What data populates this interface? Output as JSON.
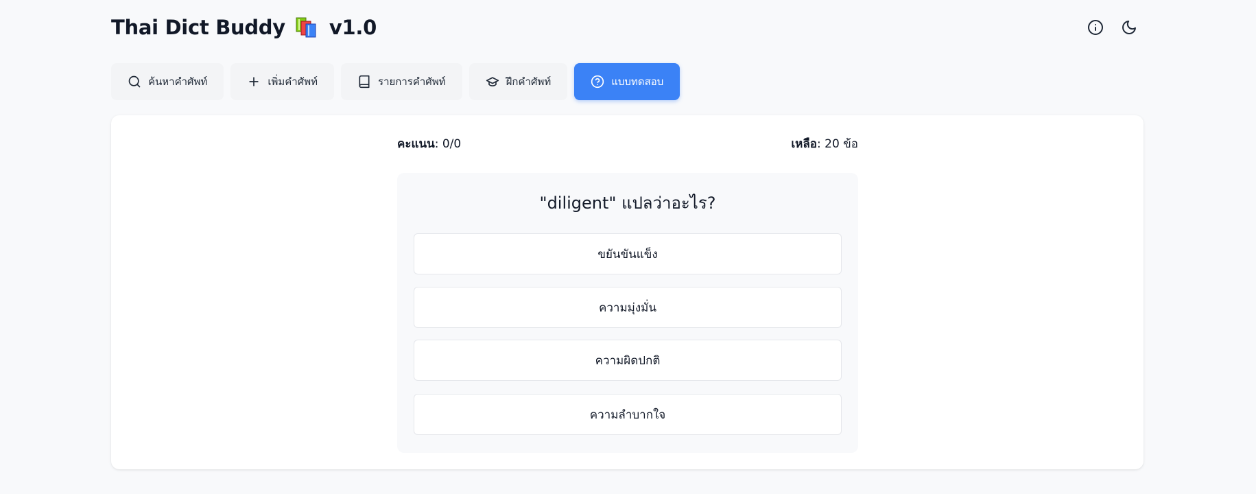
{
  "app": {
    "title": "Thai Dict Buddy",
    "logo_icon": "books-icon",
    "version": "v1.0"
  },
  "header_actions": [
    {
      "name": "info-icon"
    },
    {
      "name": "moon-icon"
    }
  ],
  "nav": {
    "tabs": [
      {
        "label": "ค้นหาคำศัพท์",
        "icon": "search-icon"
      },
      {
        "label": "เพิ่มคำศัพท์",
        "icon": "plus-icon"
      },
      {
        "label": "รายการคำศัพท์",
        "icon": "book-icon"
      },
      {
        "label": "ฝึกคำศัพท์",
        "icon": "graduation-cap-icon"
      },
      {
        "label": "แบบทดสอบ",
        "icon": "help-circle-icon",
        "active": true
      }
    ]
  },
  "quiz": {
    "score_label": "คะแนน",
    "score_value": ": 0/0",
    "remaining_label": "เหลือ",
    "remaining_value": ": 20 ข้อ",
    "question": "\"diligent\" แปลว่าอะไร?",
    "options": [
      "ขยันขันแข็ง",
      "ความมุ่งมั่น",
      "ความผิดปกติ",
      "ความลำบากใจ"
    ]
  },
  "colors": {
    "accent": "#3b82f6",
    "background": "#f8f9fb",
    "card": "#ffffff",
    "text": "#111827"
  }
}
